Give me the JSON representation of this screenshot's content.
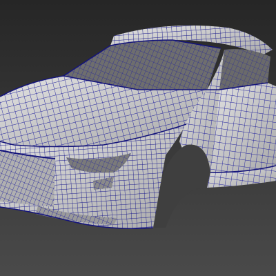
{
  "viewport": {
    "background_top": "#262626",
    "background_bottom": "#4a4a4a"
  },
  "model": {
    "surface_color": "#d3d3d3",
    "surface_shadow": "#9a9a9a",
    "opening_color": "#6e6e6e",
    "wire_color": "#1f1f9c",
    "wire_dense_color": "#14147a"
  }
}
